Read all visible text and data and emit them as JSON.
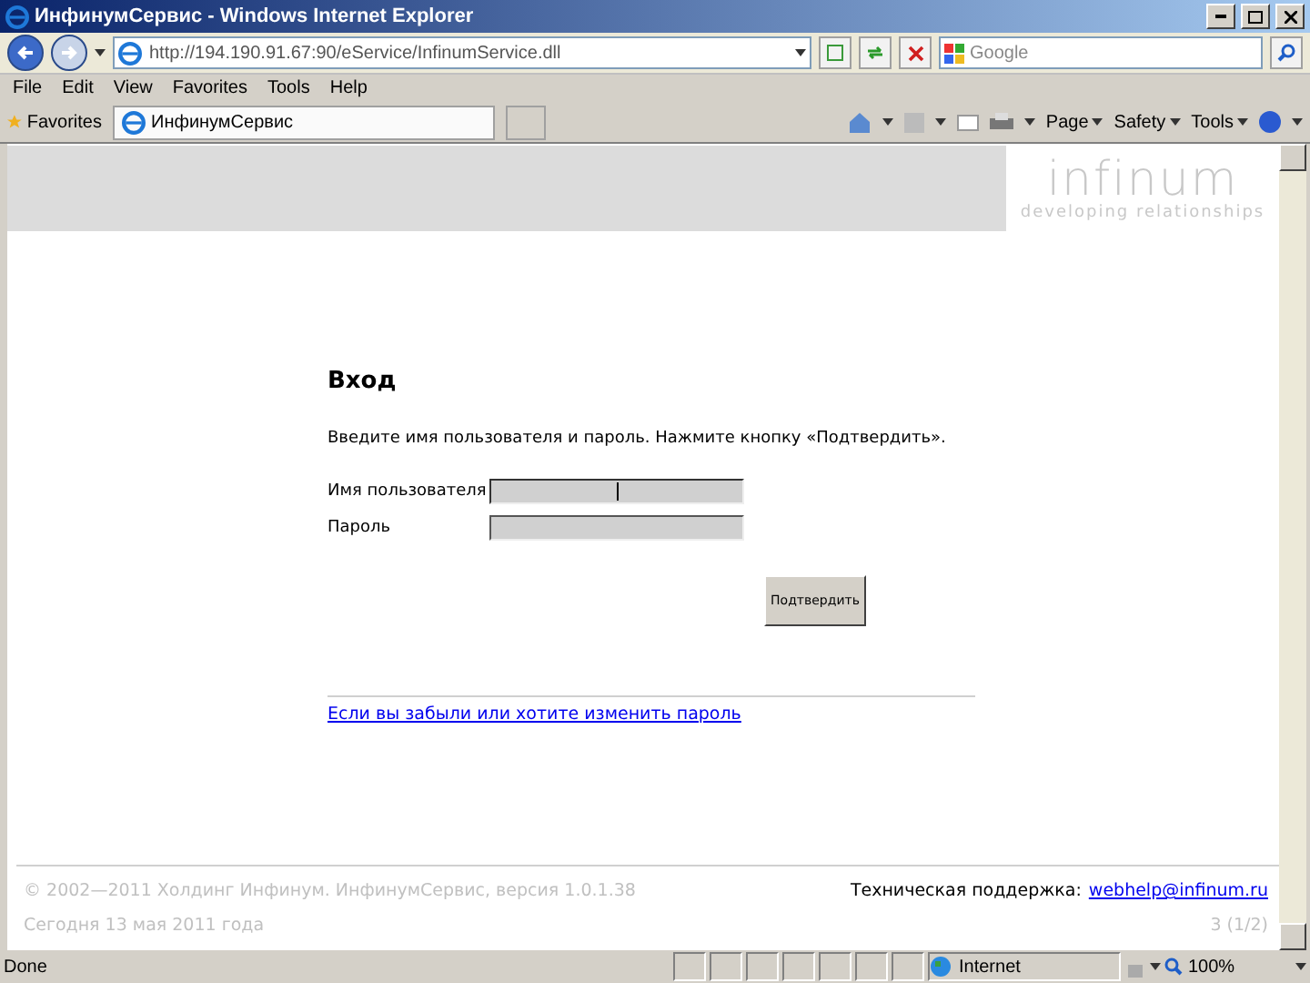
{
  "window": {
    "title": "ИнфинумСервис - Windows Internet Explorer"
  },
  "address_bar": {
    "url": "http://194.190.91.67:90/eService/InfinumService.dll",
    "search_placeholder": "Google"
  },
  "menu": [
    "File",
    "Edit",
    "View",
    "Favorites",
    "Tools",
    "Help"
  ],
  "favorites_bar": {
    "label": "Favorites",
    "tab_title": "ИнфинумСервис",
    "commands": [
      "Page",
      "Safety",
      "Tools"
    ]
  },
  "page": {
    "logo": {
      "name": "infinum",
      "tagline": "developing relationships"
    },
    "heading": "Вход",
    "instructions": "Введите имя пользователя и пароль. Нажмите кнопку «Подтвердить».",
    "fields": [
      {
        "label": "Имя пользователя",
        "focused": true
      },
      {
        "label": "Пароль",
        "focused": false
      }
    ],
    "submit": "Подтвердить",
    "forgot_link": "Если вы забыли или хотите изменить пароль",
    "footer": {
      "copyright": "© 2002—2011 Холдинг Инфинум. ИнфинумСервис, версия 1.0.1.38",
      "support_label": "Техническая поддержка:",
      "support_email": "webhelp@infinum.ru",
      "date": "Сегодня 13 мая 2011 года",
      "counter": "3 (1/2)"
    }
  },
  "status_bar": {
    "text": "Done",
    "zone": "Internet",
    "zoom": "100%"
  }
}
